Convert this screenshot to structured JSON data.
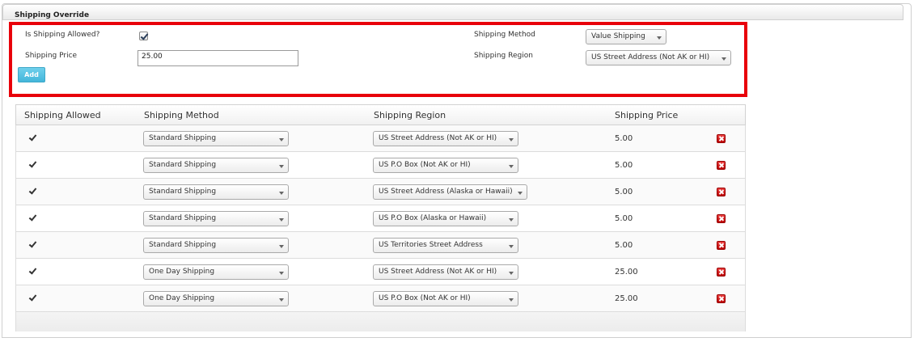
{
  "panel": {
    "title": "Shipping Override"
  },
  "form": {
    "is_shipping_allowed_label": "Is Shipping Allowed?",
    "is_shipping_allowed": true,
    "shipping_price_label": "Shipping Price",
    "shipping_price_value": "25.00",
    "shipping_method_label": "Shipping Method",
    "shipping_method_value": "Value Shipping",
    "shipping_region_label": "Shipping Region",
    "shipping_region_value": "US Street Address (Not AK or HI)",
    "add_label": "Add"
  },
  "table": {
    "headers": [
      "Shipping Allowed",
      "Shipping Method",
      "Shipping Region",
      "Shipping Price"
    ],
    "rows": [
      {
        "allowed": true,
        "method": "Standard Shipping",
        "region": "US Street Address (Not AK or HI)",
        "price": "5.00"
      },
      {
        "allowed": true,
        "method": "Standard Shipping",
        "region": "US P.O Box (Not AK or HI)",
        "price": "5.00"
      },
      {
        "allowed": true,
        "method": "Standard Shipping",
        "region": "US Street Address (Alaska or Hawaii)",
        "price": "5.00"
      },
      {
        "allowed": true,
        "method": "Standard Shipping",
        "region": "US P.O Box (Alaska or Hawaii)",
        "price": "5.00"
      },
      {
        "allowed": true,
        "method": "Standard Shipping",
        "region": "US Territories Street Address",
        "price": "5.00"
      },
      {
        "allowed": true,
        "method": "One Day Shipping",
        "region": "US Street Address (Not AK or HI)",
        "price": "25.00"
      },
      {
        "allowed": true,
        "method": "One Day Shipping",
        "region": "US P.O Box (Not AK or HI)",
        "price": "25.00"
      }
    ]
  },
  "colors": {
    "highlight": "#e8000a",
    "add_button": "#43b6da",
    "delete_icon": "#cc1111"
  }
}
